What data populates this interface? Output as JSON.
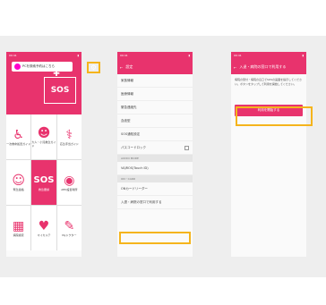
{
  "phone1": {
    "status_time": "09:41",
    "banner_text": "PCを検索予約はこちら",
    "sos_label": "SOS",
    "tiles": [
      {
        "label": "一次救命処置ガイド",
        "icon": "first-aid-icon"
      },
      {
        "label": "大人・小児救急ガイド",
        "icon": "patient-icon"
      },
      {
        "label": "応急手当ガイド",
        "icon": "doctor-icon"
      },
      {
        "label": "緊急連絡",
        "icon": "group-icon"
      },
      {
        "label": "救急要請",
        "icon": "sos-icon"
      },
      {
        "label": "AED設置場所",
        "icon": "map-pin-icon"
      },
      {
        "label": "病院検索",
        "icon": "building-icon"
      },
      {
        "label": "マイカルテ",
        "icon": "card-icon"
      },
      {
        "label": "Myドクター",
        "icon": "ticket-icon"
      }
    ]
  },
  "phone2": {
    "title": "設定",
    "rows": [
      "家族情報",
      "医療情報",
      "緊急連絡先",
      "血液型",
      "SOS通知設定",
      "パスコードロック"
    ],
    "section1": "AUDIO MODE",
    "row_audio": "VAJROS(Touch ID)",
    "section2": "ON・CARD",
    "row_card": "ONカードリーダー",
    "highlighted_row": "入退・病院の窓口で利用する"
  },
  "phone3": {
    "title": "入退・病院の窓口で利用する",
    "description": "病院の受付・病院の窓口でSOSの画面を提示してください。ボタンをタップして利用を開始してください。",
    "button_label": "利用を開始する"
  }
}
